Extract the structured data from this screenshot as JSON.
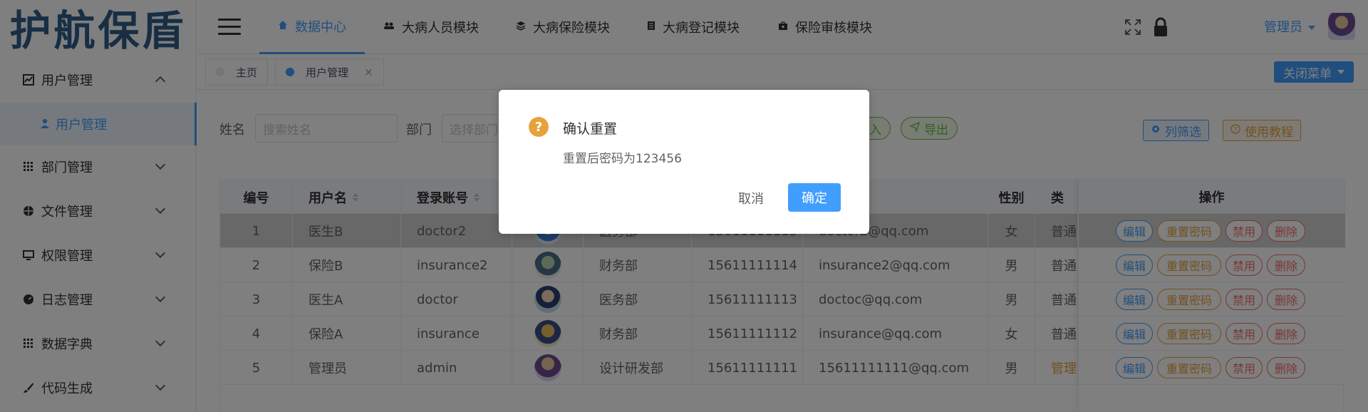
{
  "sidebar": {
    "logo": "护航保盾",
    "items": [
      {
        "label": "用户管理"
      },
      {
        "label": "部门管理"
      },
      {
        "label": "文件管理"
      },
      {
        "label": "权限管理"
      },
      {
        "label": "日志管理"
      },
      {
        "label": "数据字典"
      },
      {
        "label": "代码生成"
      }
    ],
    "sub_item": "用户管理"
  },
  "topnav": {
    "tabs": [
      "数据中心",
      "大病人员模块",
      "大病保险模块",
      "大病登记模块",
      "保险审核模块"
    ],
    "user": "管理员"
  },
  "pagetabs": {
    "home": "主页",
    "current": "用户管理",
    "close_symbol": "×",
    "close_menu": "关闭菜单"
  },
  "filters": {
    "name_label": "姓名",
    "name_placeholder": "搜索姓名",
    "dept_label": "部门",
    "dept_placeholder": "选择部门",
    "import_label": "导入",
    "export_label": "导出",
    "column_filter": "列筛选",
    "tutorial": "使用教程"
  },
  "table": {
    "headers": {
      "id": "编号",
      "username": "用户名",
      "account": "登录账号",
      "gender": "性别",
      "type": "类",
      "ops": "操作"
    },
    "rows": [
      {
        "id": "1",
        "username": "医生B",
        "account": "doctor2",
        "dept": "医务部",
        "phone": "15611111115",
        "email": "doctor2@qq.com",
        "gender": "女",
        "type": "普通"
      },
      {
        "id": "2",
        "username": "保险B",
        "account": "insurance2",
        "dept": "财务部",
        "phone": "15611111114",
        "email": "insurance2@qq.com",
        "gender": "男",
        "type": "普通"
      },
      {
        "id": "3",
        "username": "医生A",
        "account": "doctor",
        "dept": "医务部",
        "phone": "15611111113",
        "email": "doctoc@qq.com",
        "gender": "男",
        "type": "普通"
      },
      {
        "id": "4",
        "username": "保险A",
        "account": "insurance",
        "dept": "财务部",
        "phone": "15611111112",
        "email": "insurance@qq.com",
        "gender": "女",
        "type": "普通"
      },
      {
        "id": "5",
        "username": "管理员",
        "account": "admin",
        "dept": "设计研发部",
        "phone": "15611111111",
        "email": "15611111111@qq.com",
        "gender": "男",
        "type": "管理"
      }
    ],
    "ops": {
      "edit": "编辑",
      "reset": "重置密码",
      "disable": "禁用",
      "delete": "删除"
    }
  },
  "dialog": {
    "icon": "?",
    "title": "确认重置",
    "message": "重置后密码为123456",
    "cancel": "取消",
    "confirm": "确定"
  },
  "colors": {
    "primary": "#409eff",
    "warning": "#e6a23c",
    "danger": "#f56c6c",
    "success": "#67c23a"
  },
  "icons": [
    "menu-icon",
    "home-icon",
    "users-icon",
    "layers-icon",
    "document-icon",
    "briefcase-icon",
    "fullscreen-icon",
    "lock-icon",
    "question-icon",
    "gear-icon"
  ]
}
